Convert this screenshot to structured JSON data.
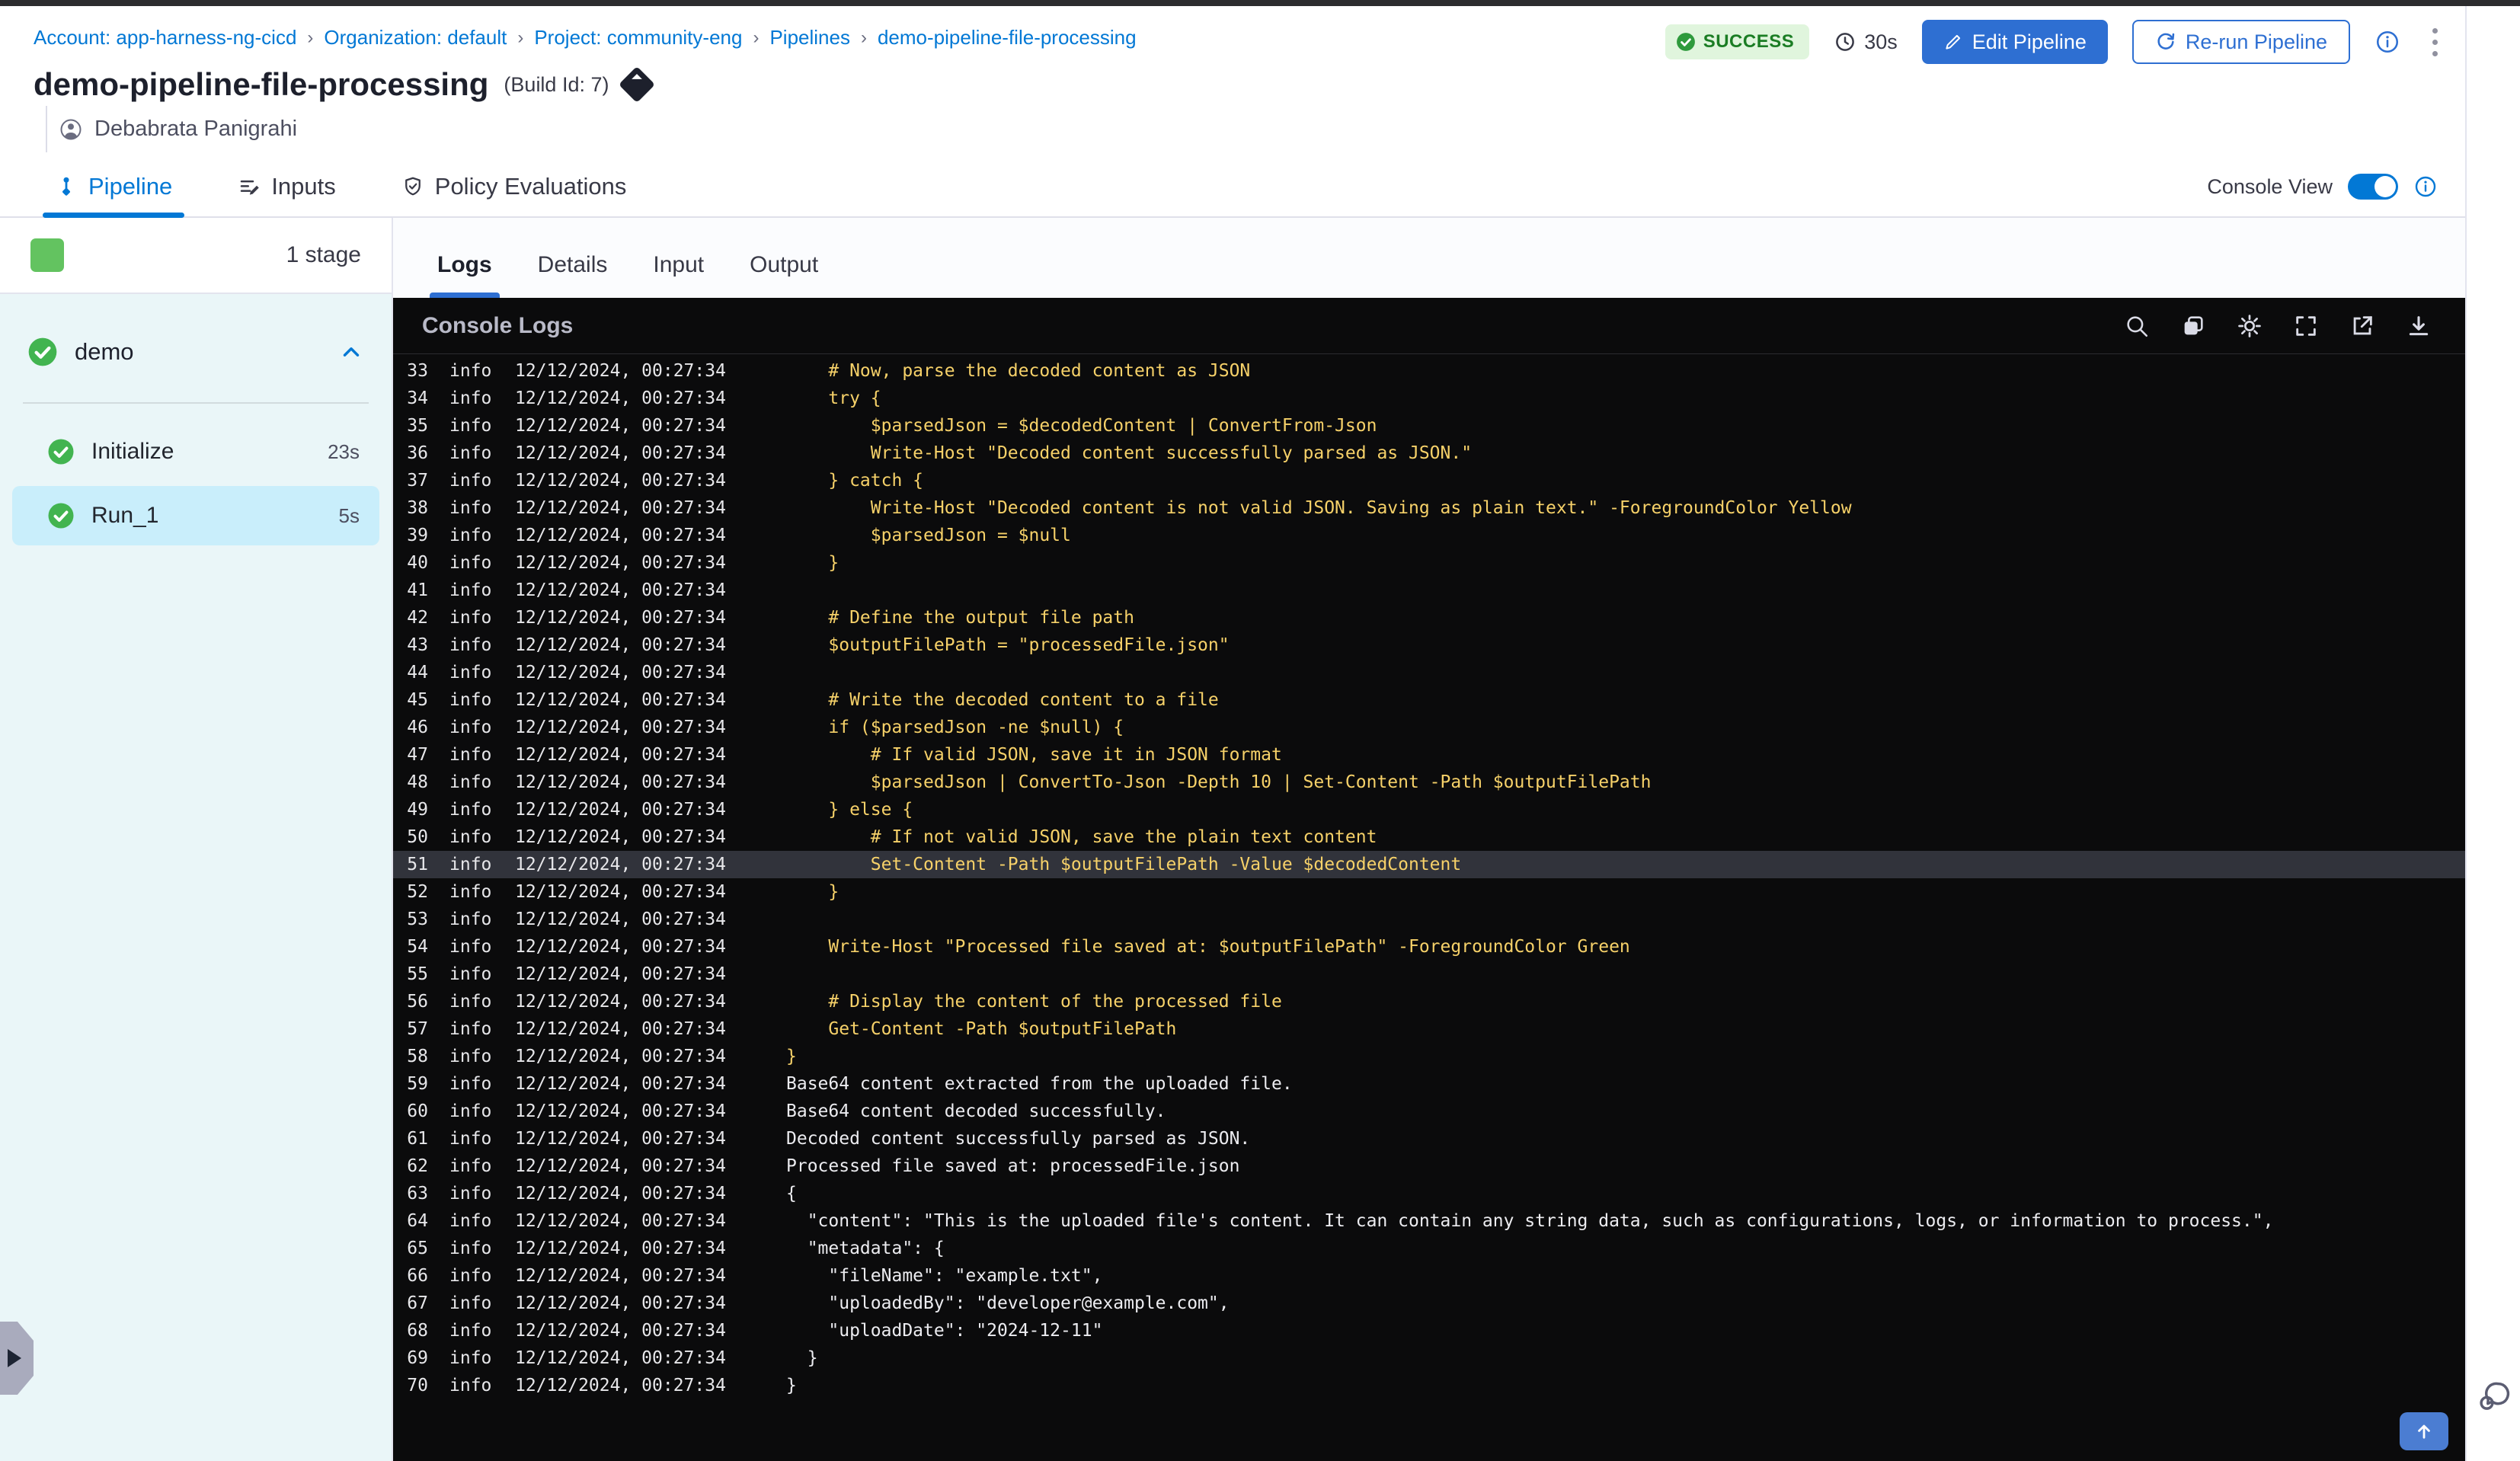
{
  "topbar": {
    "breadcrumb": {
      "separator": "›",
      "items": [
        "Account: app-harness-ng-cicd",
        "Organization: default",
        "Project: community-eng",
        "Pipelines",
        "demo-pipeline-file-processing"
      ]
    },
    "status_badge": "SUCCESS",
    "duration": "30s",
    "edit_button": "Edit Pipeline",
    "rerun_button": "Re-run Pipeline"
  },
  "header": {
    "title": "demo-pipeline-file-processing",
    "build_id": "(Build Id: 7)",
    "author": "Debabrata Panigrahi"
  },
  "nav_tabs": {
    "pipeline": "Pipeline",
    "inputs": "Inputs",
    "policy": "Policy Evaluations"
  },
  "console_view": {
    "label": "Console View",
    "enabled": true
  },
  "sidebar": {
    "stage_count": "1 stage",
    "stage": {
      "name": "demo"
    },
    "steps": [
      {
        "name": "Initialize",
        "duration": "23s",
        "selected": false
      },
      {
        "name": "Run_1",
        "duration": "5s",
        "selected": true
      }
    ]
  },
  "log_panel": {
    "tabs": [
      "Logs",
      "Details",
      "Input",
      "Output"
    ],
    "active_tab": "Logs",
    "console_title": "Console Logs",
    "header_icons": [
      "search-icon",
      "copy-icon",
      "settings-icon",
      "fullscreen-icon",
      "open-in-new-icon",
      "download-icon"
    ],
    "lines": [
      {
        "num": 33,
        "level": "info",
        "time": "12/12/2024, 00:27:34",
        "kind": "script",
        "text": "    # Now, parse the decoded content as JSON"
      },
      {
        "num": 34,
        "level": "info",
        "time": "12/12/2024, 00:27:34",
        "kind": "script",
        "text": "    try {"
      },
      {
        "num": 35,
        "level": "info",
        "time": "12/12/2024, 00:27:34",
        "kind": "script",
        "text": "        $parsedJson = $decodedContent | ConvertFrom-Json"
      },
      {
        "num": 36,
        "level": "info",
        "time": "12/12/2024, 00:27:34",
        "kind": "script",
        "text": "        Write-Host \"Decoded content successfully parsed as JSON.\""
      },
      {
        "num": 37,
        "level": "info",
        "time": "12/12/2024, 00:27:34",
        "kind": "script",
        "text": "    } catch {"
      },
      {
        "num": 38,
        "level": "info",
        "time": "12/12/2024, 00:27:34",
        "kind": "script",
        "text": "        Write-Host \"Decoded content is not valid JSON. Saving as plain text.\" -ForegroundColor Yellow"
      },
      {
        "num": 39,
        "level": "info",
        "time": "12/12/2024, 00:27:34",
        "kind": "script",
        "text": "        $parsedJson = $null"
      },
      {
        "num": 40,
        "level": "info",
        "time": "12/12/2024, 00:27:34",
        "kind": "script",
        "text": "    }"
      },
      {
        "num": 41,
        "level": "info",
        "time": "12/12/2024, 00:27:34",
        "kind": "script",
        "text": ""
      },
      {
        "num": 42,
        "level": "info",
        "time": "12/12/2024, 00:27:34",
        "kind": "script",
        "text": "    # Define the output file path"
      },
      {
        "num": 43,
        "level": "info",
        "time": "12/12/2024, 00:27:34",
        "kind": "script",
        "text": "    $outputFilePath = \"processedFile.json\""
      },
      {
        "num": 44,
        "level": "info",
        "time": "12/12/2024, 00:27:34",
        "kind": "script",
        "text": ""
      },
      {
        "num": 45,
        "level": "info",
        "time": "12/12/2024, 00:27:34",
        "kind": "script",
        "text": "    # Write the decoded content to a file"
      },
      {
        "num": 46,
        "level": "info",
        "time": "12/12/2024, 00:27:34",
        "kind": "script",
        "text": "    if ($parsedJson -ne $null) {"
      },
      {
        "num": 47,
        "level": "info",
        "time": "12/12/2024, 00:27:34",
        "kind": "script",
        "text": "        # If valid JSON, save it in JSON format"
      },
      {
        "num": 48,
        "level": "info",
        "time": "12/12/2024, 00:27:34",
        "kind": "script",
        "text": "        $parsedJson | ConvertTo-Json -Depth 10 | Set-Content -Path $outputFilePath"
      },
      {
        "num": 49,
        "level": "info",
        "time": "12/12/2024, 00:27:34",
        "kind": "script",
        "text": "    } else {"
      },
      {
        "num": 50,
        "level": "info",
        "time": "12/12/2024, 00:27:34",
        "kind": "script",
        "text": "        # If not valid JSON, save the plain text content"
      },
      {
        "num": 51,
        "level": "info",
        "time": "12/12/2024, 00:27:34",
        "kind": "script",
        "text": "        Set-Content -Path $outputFilePath -Value $decodedContent",
        "highlight": true
      },
      {
        "num": 52,
        "level": "info",
        "time": "12/12/2024, 00:27:34",
        "kind": "script",
        "text": "    }"
      },
      {
        "num": 53,
        "level": "info",
        "time": "12/12/2024, 00:27:34",
        "kind": "script",
        "text": ""
      },
      {
        "num": 54,
        "level": "info",
        "time": "12/12/2024, 00:27:34",
        "kind": "script",
        "text": "    Write-Host \"Processed file saved at: $outputFilePath\" -ForegroundColor Green"
      },
      {
        "num": 55,
        "level": "info",
        "time": "12/12/2024, 00:27:34",
        "kind": "script",
        "text": ""
      },
      {
        "num": 56,
        "level": "info",
        "time": "12/12/2024, 00:27:34",
        "kind": "script",
        "text": "    # Display the content of the processed file"
      },
      {
        "num": 57,
        "level": "info",
        "time": "12/12/2024, 00:27:34",
        "kind": "script",
        "text": "    Get-Content -Path $outputFilePath"
      },
      {
        "num": 58,
        "level": "info",
        "time": "12/12/2024, 00:27:34",
        "kind": "script",
        "text": "}"
      },
      {
        "num": 59,
        "level": "info",
        "time": "12/12/2024, 00:27:34",
        "kind": "output",
        "text": "Base64 content extracted from the uploaded file."
      },
      {
        "num": 60,
        "level": "info",
        "time": "12/12/2024, 00:27:34",
        "kind": "output",
        "text": "Base64 content decoded successfully."
      },
      {
        "num": 61,
        "level": "info",
        "time": "12/12/2024, 00:27:34",
        "kind": "output",
        "text": "Decoded content successfully parsed as JSON."
      },
      {
        "num": 62,
        "level": "info",
        "time": "12/12/2024, 00:27:34",
        "kind": "output",
        "text": "Processed file saved at: processedFile.json"
      },
      {
        "num": 63,
        "level": "info",
        "time": "12/12/2024, 00:27:34",
        "kind": "output",
        "text": "{"
      },
      {
        "num": 64,
        "level": "info",
        "time": "12/12/2024, 00:27:34",
        "kind": "output",
        "text": "  \"content\": \"This is the uploaded file's content. It can contain any string data, such as configurations, logs, or information to process.\","
      },
      {
        "num": 65,
        "level": "info",
        "time": "12/12/2024, 00:27:34",
        "kind": "output",
        "text": "  \"metadata\": {"
      },
      {
        "num": 66,
        "level": "info",
        "time": "12/12/2024, 00:27:34",
        "kind": "output",
        "text": "    \"fileName\": \"example.txt\","
      },
      {
        "num": 67,
        "level": "info",
        "time": "12/12/2024, 00:27:34",
        "kind": "output",
        "text": "    \"uploadedBy\": \"developer@example.com\","
      },
      {
        "num": 68,
        "level": "info",
        "time": "12/12/2024, 00:27:34",
        "kind": "output",
        "text": "    \"uploadDate\": \"2024-12-11\""
      },
      {
        "num": 69,
        "level": "info",
        "time": "12/12/2024, 00:27:34",
        "kind": "output",
        "text": "  }"
      },
      {
        "num": 70,
        "level": "info",
        "time": "12/12/2024, 00:27:34",
        "kind": "output",
        "text": "}"
      }
    ]
  },
  "colors": {
    "accent_link": "#0278d5",
    "accent_button": "#2e6fd2",
    "success_badge_bg": "#e0f5dd",
    "success_badge_text": "#1b7d24",
    "success_green": "#42b450",
    "console_bg": "#0b0b0c",
    "script_yellow": "#f6d169",
    "output_white": "#ececf0",
    "selected_step_bg": "#c9eefb",
    "sidebar_bg": "#eaf6f8",
    "highlight_row_bg": "#31333b"
  }
}
